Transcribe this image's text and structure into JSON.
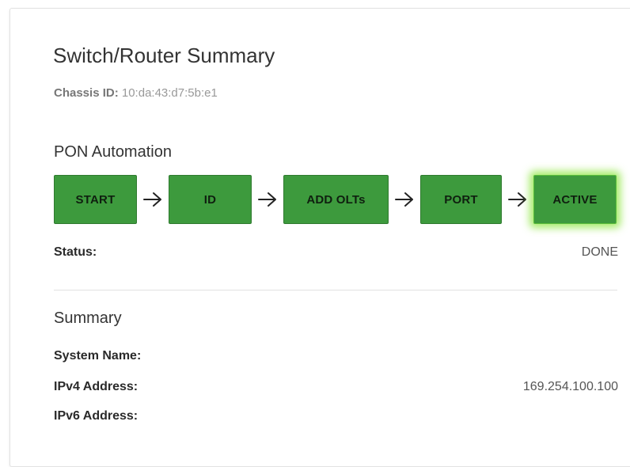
{
  "header": {
    "title": "Switch/Router Summary",
    "chassis_label": "Chassis ID:",
    "chassis_id": "10:da:43:d7:5b:e1"
  },
  "pon_automation": {
    "title": "PON Automation",
    "steps": [
      {
        "label": "START"
      },
      {
        "label": "ID"
      },
      {
        "label": "ADD OLTs"
      },
      {
        "label": "PORT"
      },
      {
        "label": "ACTIVE"
      }
    ],
    "active_step": "ACTIVE",
    "status_label": "Status:",
    "status_value": "DONE",
    "colors": {
      "step_fill": "#3d9a3d",
      "active_glow": "#91e646"
    }
  },
  "summary": {
    "title": "Summary",
    "fields": [
      {
        "label": "System Name:",
        "value": ""
      },
      {
        "label": "IPv4 Address:",
        "value": "169.254.100.100"
      },
      {
        "label": "IPv6 Address:",
        "value": ""
      }
    ]
  }
}
